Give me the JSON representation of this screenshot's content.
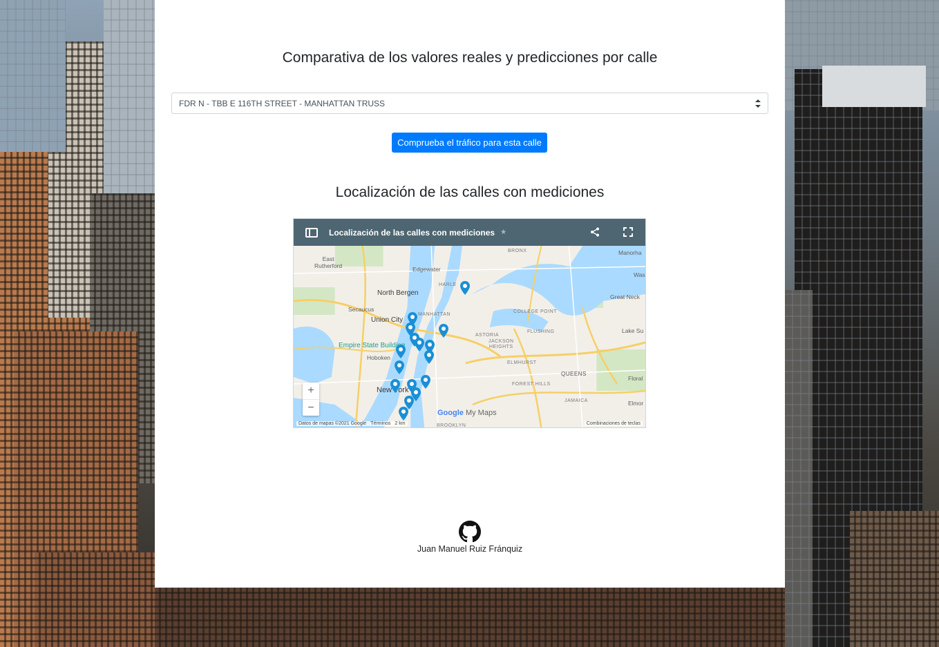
{
  "page": {
    "title": "Comparativa de los valores reales y predicciones por calle",
    "map_section_title": "Localización de las calles con mediciones",
    "author": "Juan Manuel Ruiz Fránquiz"
  },
  "street_select": {
    "selected": "FDR N - TBB E 116TH STREET - MANHATTAN TRUSS"
  },
  "check_button": {
    "label": "Comprueba el tráfico para esta calle"
  },
  "map": {
    "title": "Localización de las calles con mediciones",
    "attribution": "Datos de mapas ©2021 Google",
    "terms": "Términos",
    "scale": "2 km",
    "shortcuts": "Combinaciones de teclas",
    "logo_google": "Google",
    "logo_mymaps": "My Maps",
    "zoom_in": "+",
    "zoom_out": "−",
    "labels": {
      "bronx": "BRONX",
      "manorhaven": "Manorha",
      "east_rutherford": "East\nRutherford",
      "edgewater": "Edgewater",
      "harlem": "HARLE",
      "north_bergen": "North Bergen",
      "secaucus": "Secaucus",
      "union_city": "Union City",
      "manhattan": "MANHATTAN",
      "astoria": "ASTORIA",
      "college_point": "COLLEGE POINT",
      "flushing": "FLUSHING",
      "great_neck": "Great Neck",
      "lake_success": "Lake Su",
      "jackson_heights": "JACKSON\nHEIGHTS",
      "empire_state": "Empire State Building",
      "hoboken": "Hoboken",
      "elmhurst": "ELMHURST",
      "queens": "QUEENS",
      "floral": "Floral",
      "forest_hills": "FOREST HILLS",
      "jamaica": "JAMAICA",
      "new_york": "New York",
      "elmont": "Elmor",
      "brooklyn": "BROOKLYN",
      "was": "Was"
    }
  },
  "colors": {
    "primary_button": "#007bff",
    "map_header": "#4d6672",
    "pin": "#1a8fd6",
    "water": "#aadaff",
    "land": "#f2efe9"
  }
}
